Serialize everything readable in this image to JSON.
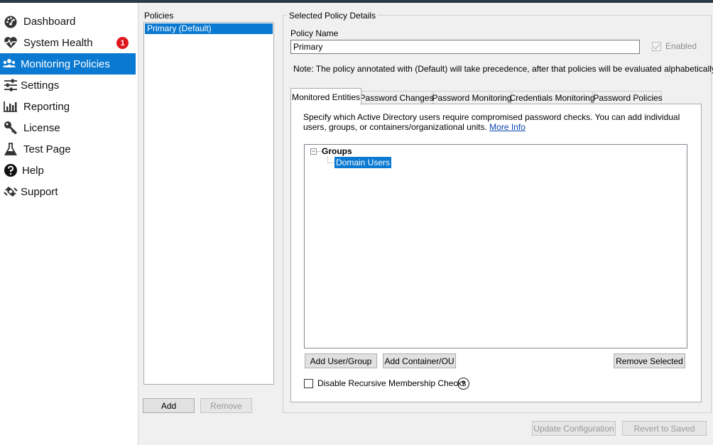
{
  "sidebar": {
    "items": [
      {
        "label": "Dashboard",
        "icon": "dashboard-icon"
      },
      {
        "label": "System Health",
        "icon": "heartbeat-icon",
        "badge": "1"
      },
      {
        "label": "Monitoring Policies",
        "icon": "users-icon"
      },
      {
        "label": "Settings",
        "icon": "sliders-icon"
      },
      {
        "label": "Reporting",
        "icon": "bar-chart-icon"
      },
      {
        "label": "License",
        "icon": "key-icon"
      },
      {
        "label": "Test Page",
        "icon": "flask-icon"
      },
      {
        "label": "Help",
        "icon": "question-circle-icon"
      },
      {
        "label": "Support",
        "icon": "support-icon"
      }
    ],
    "selected": "Monitoring Policies"
  },
  "policies": {
    "label": "Policies",
    "items": [
      "Primary (Default)"
    ],
    "add_label": "Add",
    "remove_label": "Remove"
  },
  "details": {
    "title": "Selected Policy Details",
    "policy_name_label": "Policy Name",
    "policy_name_value": "Primary",
    "enabled_label": "Enabled",
    "note": "Note: The policy annotated with (Default) will take precedence, after that policies will be evaluated alphabetically.",
    "tabs": [
      "Monitored Entities",
      "Password Changes",
      "Password Monitoring",
      "Credentials Monitoring",
      "Password Policies"
    ],
    "active_tab": "Monitored Entities",
    "description": "Specify which Active Directory users require compromised password checks.  You can add individual users, groups, or containers/organizational units.",
    "more_info": "More Info",
    "tree": {
      "toggle": "−",
      "group_label": "Groups",
      "child_label": "Domain Users"
    },
    "add_user_group": "Add User/Group",
    "add_container": "Add Container/OU",
    "remove_selected": "Remove Selected",
    "recursive_label": "Disable Recursive Membership Checks",
    "help_glyph": "?"
  },
  "footer": {
    "update_label": "Update Configuration",
    "revert_label": "Revert to Saved"
  },
  "colors": {
    "accent": "#0a79d1",
    "badge": "#e0161e"
  }
}
